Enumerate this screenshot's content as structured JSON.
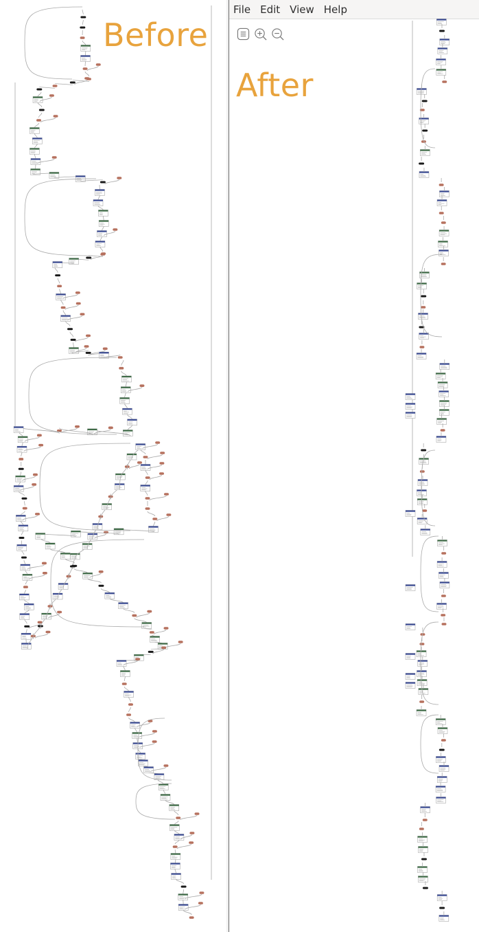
{
  "captions": {
    "before": "Before",
    "after": "After"
  },
  "menu": {
    "file": "File",
    "edit": "Edit",
    "view": "View",
    "help": "Help"
  },
  "toolbar": {
    "icons": [
      "menu-icon",
      "zoom-in-icon",
      "zoom-out-icon"
    ]
  },
  "colors": {
    "caption": "#e8a33d",
    "node_blue": "#3c4c93",
    "node_green": "#3f6b47",
    "node_salmon": "#b6715e",
    "node_black": "#1a1a1a",
    "edge": "#a9a9a9"
  }
}
